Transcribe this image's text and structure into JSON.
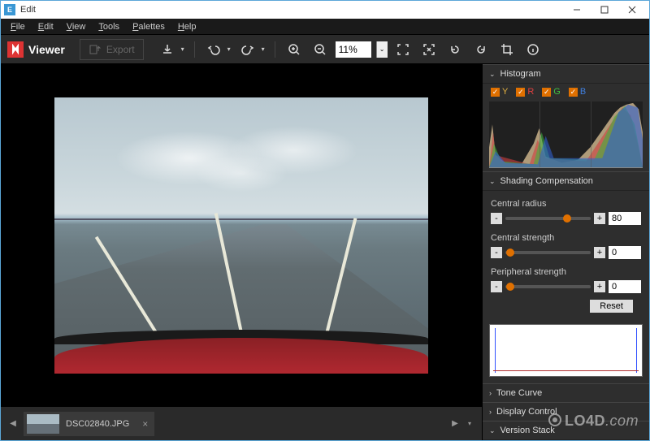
{
  "window": {
    "title": "Edit"
  },
  "menu": {
    "file": "File",
    "edit": "Edit",
    "view": "View",
    "tools": "Tools",
    "palettes": "Palettes",
    "help": "Help"
  },
  "toolbar": {
    "viewer": "Viewer",
    "export": "Export",
    "zoom_value": "11%"
  },
  "filmstrip": {
    "filename": "DSC02840.JPG"
  },
  "panels": {
    "histogram": {
      "title": "Histogram",
      "y_label": "Y",
      "r_label": "R",
      "g_label": "G",
      "b_label": "B"
    },
    "shading": {
      "title": "Shading Compensation",
      "central_radius": {
        "label": "Central radius",
        "value": "80",
        "position_pct": 72
      },
      "central_strength": {
        "label": "Central strength",
        "value": "0",
        "position_pct": 6
      },
      "peripheral_strength": {
        "label": "Peripheral strength",
        "value": "0",
        "position_pct": 6
      },
      "reset": "Reset"
    },
    "tone_curve": {
      "title": "Tone Curve"
    },
    "display_control": {
      "title": "Display Control"
    },
    "version_stack": {
      "title": "Version Stack"
    }
  },
  "watermark": "LO4D.com"
}
